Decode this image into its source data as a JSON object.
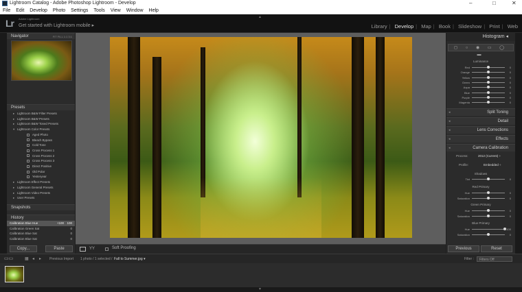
{
  "window": {
    "title": "Lightroom Catalog - Adobe Photoshop Lightroom - Develop",
    "controls": [
      "–",
      "□",
      "✕"
    ]
  },
  "menu": [
    "File",
    "Edit",
    "Develop",
    "Photo",
    "Settings",
    "Tools",
    "View",
    "Window",
    "Help"
  ],
  "identity": {
    "logo": "Lr",
    "account": "Adobe Lightroom",
    "mobile": "Get started with Lightroom mobile ▸"
  },
  "modules": [
    "Library",
    "Develop",
    "Map",
    "Book",
    "Slideshow",
    "Print",
    "Web"
  ],
  "active_module": "Develop",
  "navigator": {
    "title": "Navigator",
    "zoom": "FIT   FILL   1:1   3:1"
  },
  "presets": {
    "title": "Presets",
    "folders": [
      {
        "label": "Lightroom B&W Filter Presets"
      },
      {
        "label": "Lightroom B&W Presets"
      },
      {
        "label": "Lightroom B&W Toned Presets"
      },
      {
        "label": "Lightroom Color Presets",
        "open": true
      }
    ],
    "color_items": [
      "Aged Photo",
      "Bleach Bypass",
      "Cold Tone",
      "Cross Process 1",
      "Cross Process 2",
      "Cross Process 3",
      "Direct Positive",
      "Old Polar",
      "Yesteryear"
    ],
    "more_folders": [
      "Lightroom Effect Presets",
      "Lightroom General Presets",
      "Lightroom Video Presets",
      "User Presets"
    ]
  },
  "snapshots": {
    "title": "Snapshots"
  },
  "history": {
    "title": "History",
    "items": [
      {
        "label": "Calibration Blue Hue",
        "v1": "+100",
        "v2": "100",
        "selected": true
      },
      {
        "label": "Calibration Green Sat",
        "v1": "",
        "v2": "0",
        "selected": false
      },
      {
        "label": "Calibration Blue Sat",
        "v1": "",
        "v2": "0",
        "selected": false
      },
      {
        "label": "Calibration Blue Sat",
        "v1": "",
        "v2": "0",
        "selected": false
      }
    ]
  },
  "left_buttons": {
    "copy": "Copy...",
    "paste": "Paste"
  },
  "toolbar": {
    "soft_proofing": "Soft Proofing",
    "view_mode": "YY"
  },
  "right": {
    "histogram": "Histogram",
    "tools_icons": "◻ ○ ◉ ▭ ◯ ▬",
    "hsl_label": "Luminance",
    "hsl_sliders": [
      {
        "label": "Red",
        "value": "0",
        "pos": 0.5
      },
      {
        "label": "Orange",
        "value": "0",
        "pos": 0.5
      },
      {
        "label": "Yellow",
        "value": "0",
        "pos": 0.5
      },
      {
        "label": "Green",
        "value": "0",
        "pos": 0.5
      },
      {
        "label": "Aqua",
        "value": "0",
        "pos": 0.5
      },
      {
        "label": "Blue",
        "value": "0",
        "pos": 0.5
      },
      {
        "label": "Purple",
        "value": "0",
        "pos": 0.5
      },
      {
        "label": "Magenta",
        "value": "0",
        "pos": 0.5
      }
    ],
    "sections": [
      "Split Toning",
      "Detail",
      "Lens Corrections",
      "Effects",
      "Camera Calibration"
    ],
    "calibration": {
      "process_label": "Process:",
      "process_value": "2012 (Current) ÷",
      "profile_label": "Profile:",
      "profile_value": "Embedded ÷",
      "shadows": "Shadows",
      "tint": {
        "label": "Tint",
        "value": "0",
        "pos": 0.5
      },
      "red_primary": "Red Primary",
      "red_hue": {
        "label": "Hue",
        "value": "0",
        "pos": 0.5
      },
      "red_sat": {
        "label": "Saturation",
        "value": "0",
        "pos": 0.5
      },
      "green_primary": "Green Primary",
      "green_hue": {
        "label": "Hue",
        "value": "0",
        "pos": 0.5
      },
      "green_sat": {
        "label": "Saturation",
        "value": "0",
        "pos": 0.5
      },
      "blue_primary": "Blue Primary",
      "blue_hue": {
        "label": "Hue",
        "value": "+ 100",
        "pos": 1.0
      },
      "blue_sat": {
        "label": "Saturation",
        "value": "0",
        "pos": 0.5
      }
    },
    "buttons": {
      "previous": "Previous",
      "reset": "Reset"
    }
  },
  "filmstrip": {
    "source": "Previous Import",
    "info": "1 photo / 1 selected /",
    "filename": "Fall to Summer.jpg ▾",
    "filter_label": "Filter :",
    "filter_value": "Filters Off"
  },
  "colors": {
    "accent": "#e6e6e6",
    "panel": "#2b2b2b",
    "background": "#1f1f1f"
  }
}
